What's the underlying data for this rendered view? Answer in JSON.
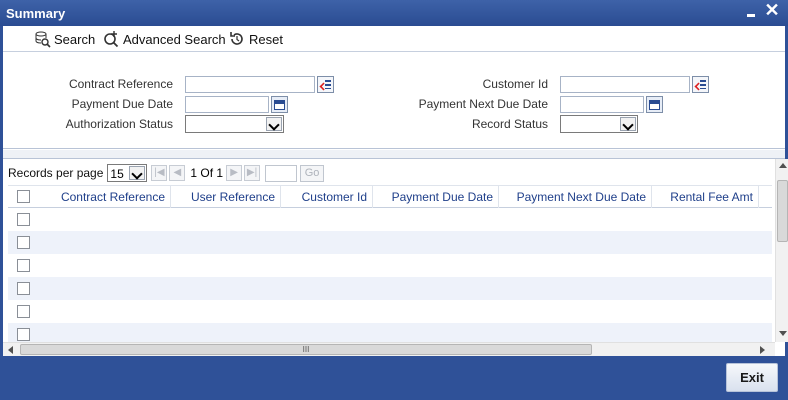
{
  "window": {
    "title": "Summary",
    "minimize_icon": "minimize-icon",
    "close_icon": "close-icon",
    "close_glyph": "✕"
  },
  "toolbar": {
    "search": "Search",
    "advanced_search": "Advanced Search",
    "reset": "Reset"
  },
  "criteria": {
    "contract_reference": {
      "label": "Contract Reference",
      "value": ""
    },
    "customer_id": {
      "label": "Customer Id",
      "value": ""
    },
    "payment_due_date": {
      "label": "Payment Due Date",
      "value": ""
    },
    "payment_next_due_date": {
      "label": "Payment Next Due Date",
      "value": ""
    },
    "authorization_status": {
      "label": "Authorization Status",
      "value": ""
    },
    "record_status": {
      "label": "Record Status",
      "value": ""
    }
  },
  "pager": {
    "records_per_page_label": "Records per page",
    "records_per_page": "15",
    "page_info": "1 Of 1",
    "go_label": "Go"
  },
  "table": {
    "columns": [
      "Contract Reference",
      "User Reference",
      "Customer Id",
      "Payment Due Date",
      "Payment Next Due Date",
      "Rental Fee Amt"
    ],
    "rows": [
      [
        "",
        "",
        "",
        "",
        "",
        ""
      ],
      [
        "",
        "",
        "",
        "",
        "",
        ""
      ],
      [
        "",
        "",
        "",
        "",
        "",
        ""
      ],
      [
        "",
        "",
        "",
        "",
        "",
        ""
      ],
      [
        "",
        "",
        "",
        "",
        "",
        ""
      ],
      [
        "",
        "",
        "",
        "",
        "",
        ""
      ]
    ]
  },
  "scrollbar": {
    "grip": "III"
  },
  "footer": {
    "exit": "Exit"
  },
  "colors": {
    "title_bar": "#2f5198",
    "header_text": "#1f3f8a",
    "alt_row": "#eef2fa"
  }
}
